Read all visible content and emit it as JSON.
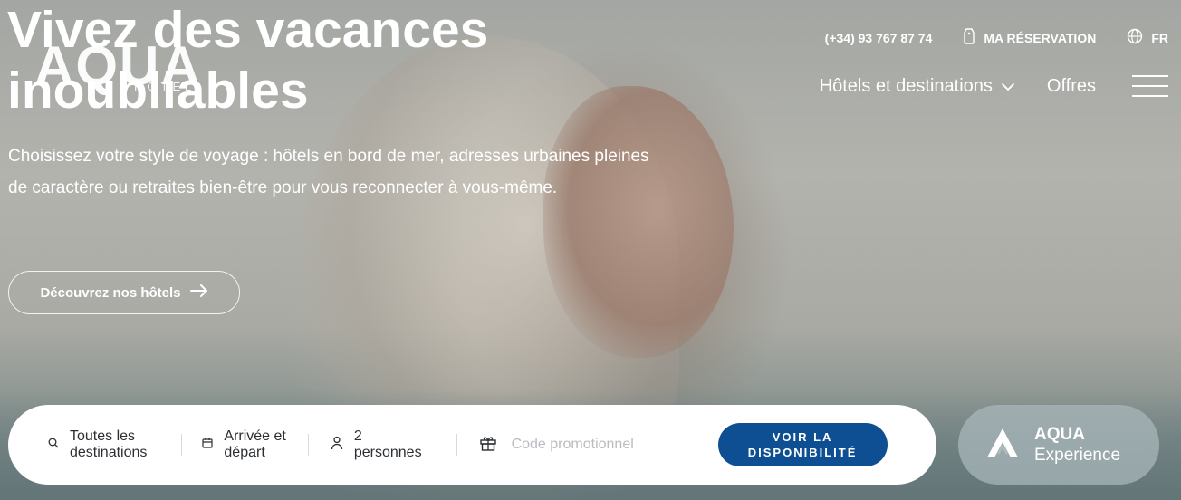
{
  "brand": {
    "logo_text": "AQUA",
    "logo_sub": "HOTEL"
  },
  "topbar": {
    "phone": "(+34) 93 767 87 74",
    "reservation_label": "MA RÉSERVATION",
    "language": "FR"
  },
  "nav": {
    "hotels_label": "Hôtels et destinations",
    "offers_label": "Offres"
  },
  "hero": {
    "title": "Vivez des vacances inoubliables",
    "subtitle": "Choisissez votre style de voyage : hôtels en bord de mer, adresses urbaines pleines de caractère ou retraites bien-être pour vous reconnecter à vous-même.",
    "cta_label": "Découvrez nos hôtels"
  },
  "booking": {
    "destination_line1": "Toutes les",
    "destination_line2": "destinations",
    "dates_line1": "Arrivée et",
    "dates_line2": "départ",
    "guests_line1": "2",
    "guests_line2": "personnes",
    "promo_placeholder": "Code promotionnel",
    "search_line1": "VOIR LA",
    "search_line2": "DISPONIBILITÉ"
  },
  "experience": {
    "title": "AQUA",
    "subtitle": "Experience"
  },
  "colors": {
    "primary": "#0d4f92",
    "white": "#ffffff",
    "text_dark": "#2b2f33",
    "placeholder": "#b9bcc0"
  }
}
